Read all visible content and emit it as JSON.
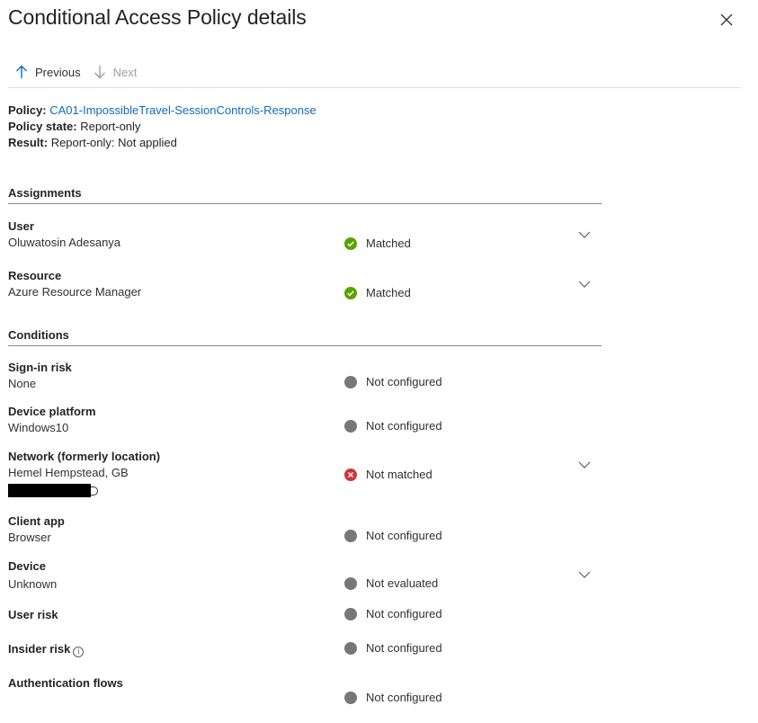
{
  "header": {
    "title": "Conditional Access Policy details"
  },
  "nav": {
    "previous": "Previous",
    "next": "Next"
  },
  "summary": {
    "policy_label": "Policy:",
    "policy_value": "CA01-ImpossibleTravel-SessionControls-Response",
    "state_label": "Policy state:",
    "state_value": "Report-only",
    "result_label": "Result:",
    "result_value": "Report-only: Not applied"
  },
  "assignments": {
    "heading": "Assignments",
    "user": {
      "name": "User",
      "value": "Oluwatosin Adesanya",
      "status": "Matched"
    },
    "resource": {
      "name": "Resource",
      "value": "Azure Resource Manager",
      "status": "Matched"
    }
  },
  "conditions": {
    "heading": "Conditions",
    "signin_risk": {
      "name": "Sign-in risk",
      "value": "None",
      "status": "Not configured"
    },
    "device_platform": {
      "name": "Device platform",
      "value": "Windows10",
      "status": "Not configured"
    },
    "network": {
      "name": "Network (formerly location)",
      "value": "Hemel Hempstead, GB",
      "status": "Not matched"
    },
    "client_app": {
      "name": "Client app",
      "value": "Browser",
      "status": "Not configured"
    },
    "device": {
      "name": "Device",
      "value": "Unknown",
      "status": "Not evaluated"
    },
    "user_risk": {
      "name": "User risk",
      "status": "Not configured"
    },
    "insider_risk": {
      "name": "Insider risk",
      "status": "Not configured"
    },
    "auth_flows": {
      "name": "Authentication flows",
      "status": "Not configured"
    }
  },
  "colors": {
    "link": "#0f6cbd",
    "matched": "#57a300",
    "not_matched": "#d13438",
    "neutral": "#797775"
  }
}
